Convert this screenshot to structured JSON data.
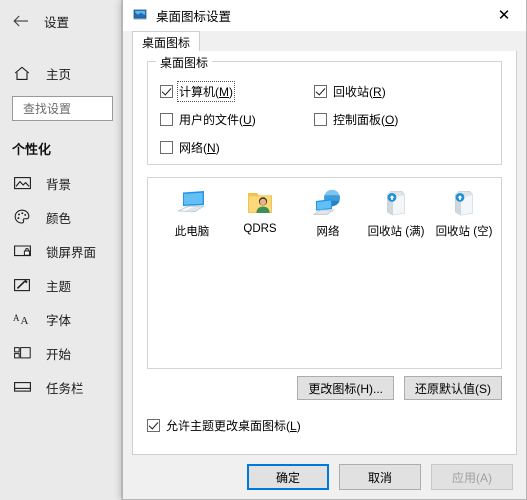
{
  "settings": {
    "title": "设置",
    "back_icon": "back-arrow-icon",
    "home": {
      "label": "主页",
      "icon": "home-icon"
    },
    "search": {
      "placeholder": "查找设置",
      "value": ""
    },
    "section_heading": "个性化",
    "nav_items": [
      {
        "label": "背景",
        "icon": "picture-icon"
      },
      {
        "label": "颜色",
        "icon": "palette-icon"
      },
      {
        "label": "锁屏界面",
        "icon": "lock-screen-icon"
      },
      {
        "label": "主题",
        "icon": "theme-brush-icon"
      },
      {
        "label": "字体",
        "icon": "font-icon"
      },
      {
        "label": "开始",
        "icon": "start-menu-icon"
      },
      {
        "label": "任务栏",
        "icon": "taskbar-icon"
      }
    ]
  },
  "dialog": {
    "title": "桌面图标设置",
    "app_icon": "desktop-icon-settings-icon",
    "close_label": "✕",
    "tabs": [
      {
        "label": "桌面图标"
      }
    ],
    "groupbox": {
      "legend": "桌面图标",
      "checkboxes": [
        {
          "label": "计算机",
          "accel": "M",
          "checked": true,
          "focused": true
        },
        {
          "label": "回收站",
          "accel": "R",
          "checked": true,
          "focused": false
        },
        {
          "label": "用户的文件",
          "accel": "U",
          "checked": false,
          "focused": false
        },
        {
          "label": "控制面板",
          "accel": "O",
          "checked": false,
          "focused": false
        },
        {
          "label": "网络",
          "accel": "N",
          "checked": false,
          "focused": false
        }
      ]
    },
    "preview": [
      {
        "caption": "此电脑",
        "icon": "this-pc-icon"
      },
      {
        "caption": "QDRS",
        "icon": "user-folder-icon"
      },
      {
        "caption": "网络",
        "icon": "network-icon"
      },
      {
        "caption": "回收站 (满)",
        "icon": "recycle-bin-full-icon"
      },
      {
        "caption": "回收站 (空)",
        "icon": "recycle-bin-empty-icon"
      }
    ],
    "panel_buttons": [
      {
        "label": "更改图标(H)...",
        "name": "change-icon-button",
        "disabled": false
      },
      {
        "label": "还原默认值(S)",
        "name": "restore-default-button",
        "disabled": false
      }
    ],
    "allow_theme": {
      "label": "允许主题更改桌面图标",
      "accel": "L",
      "checked": true
    },
    "footer_buttons": [
      {
        "label": "确定",
        "name": "ok-button",
        "default": true,
        "disabled": false
      },
      {
        "label": "取消",
        "name": "cancel-button",
        "default": false,
        "disabled": false
      },
      {
        "label": "应用(A)",
        "name": "apply-button",
        "default": false,
        "disabled": true
      }
    ]
  },
  "colors": {
    "accent": "#0078d7",
    "sidebar_bg": "#eaeaea",
    "dialog_bg": "#f0f0f0"
  }
}
